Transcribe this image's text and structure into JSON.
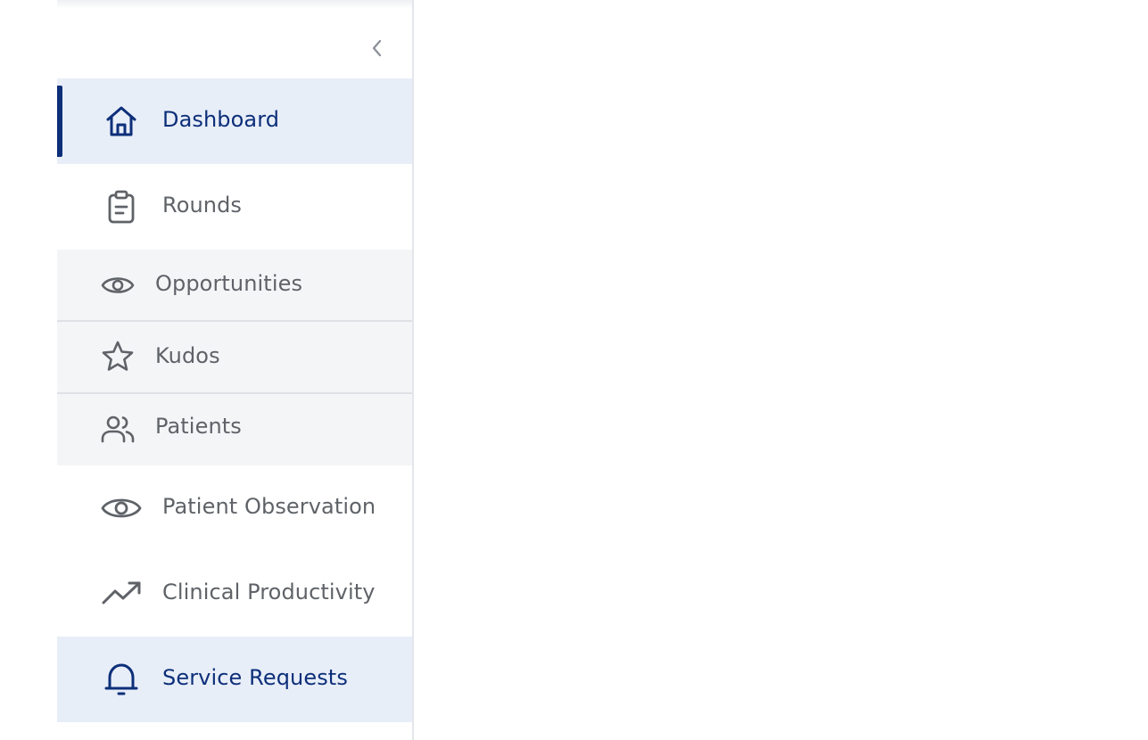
{
  "sidebar": {
    "collapse_icon": "chevron-left-icon",
    "items": [
      {
        "label": "Dashboard",
        "icon": "home-icon",
        "state": "active"
      },
      {
        "label": "Rounds",
        "icon": "clipboard-icon",
        "state": "default"
      },
      {
        "label": "Opportunities",
        "icon": "eye-icon",
        "state": "submenu"
      },
      {
        "label": "Kudos",
        "icon": "star-icon",
        "state": "submenu"
      },
      {
        "label": "Patients",
        "icon": "users-icon",
        "state": "submenu"
      },
      {
        "label": "Patient Observation",
        "icon": "eye-icon",
        "state": "default"
      },
      {
        "label": "Clinical Productivity",
        "icon": "trending-up-icon",
        "state": "default"
      },
      {
        "label": "Service Requests",
        "icon": "bell-icon",
        "state": "highlighted"
      }
    ]
  },
  "colors": {
    "accent": "#0d2f7a",
    "active_bg": "#e8eef8",
    "submenu_bg": "#f3f5f7",
    "text_muted": "#5f6368"
  }
}
